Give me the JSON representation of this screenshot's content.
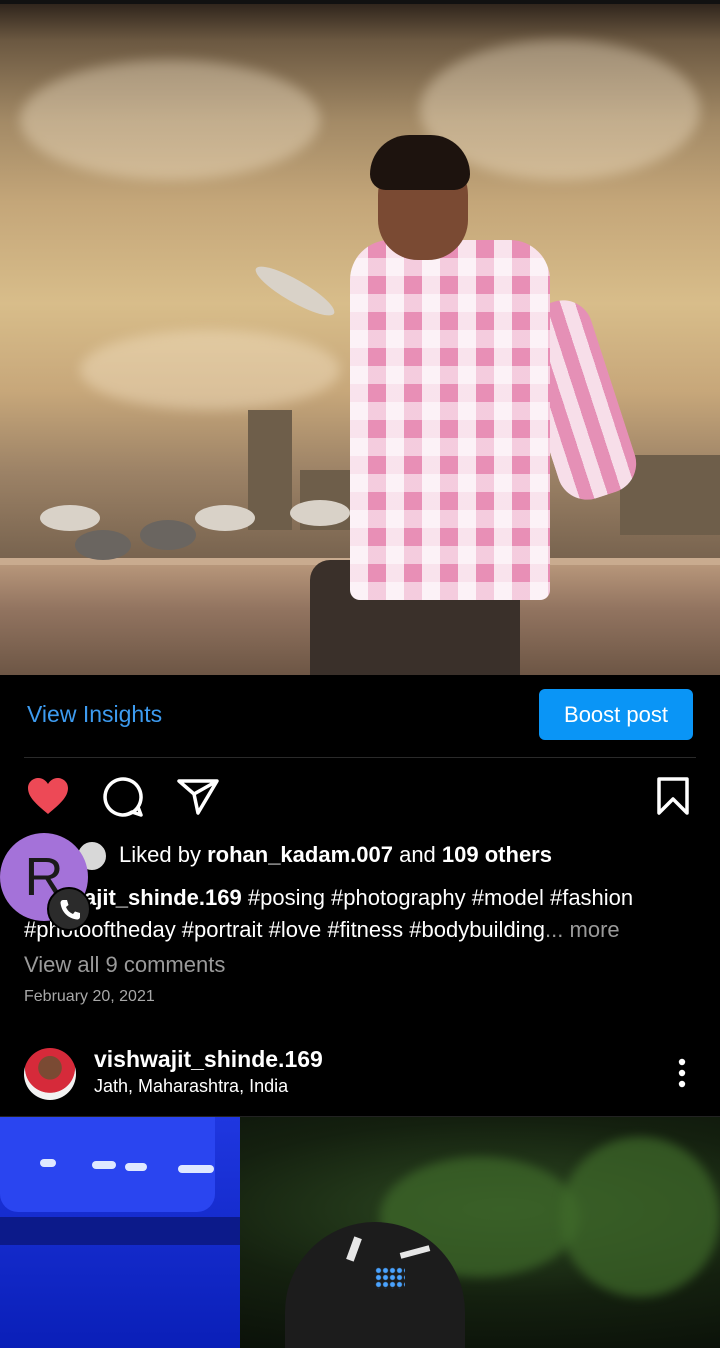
{
  "insights": {
    "view_label": "View Insights",
    "boost_label": "Boost post"
  },
  "actions": {
    "like": "heart-icon",
    "comment": "comment-icon",
    "share": "share-icon",
    "save": "bookmark-icon"
  },
  "likes": {
    "prefix": "Liked by",
    "liker": "rohan_kadam.007",
    "joiner": "and",
    "others": "109 others"
  },
  "caption": {
    "user": "ajit_shinde.169",
    "text": " #posing #photography #model #fashion #photooftheday #portrait #love #fitness #bodybuilding",
    "more_prefix": "...",
    "more": "more"
  },
  "comments_link": "View all 9 comments",
  "date": "February 20, 2021",
  "bubble": {
    "letter": "R"
  },
  "next_post": {
    "username": "vishwajit_shinde.169",
    "location": "Jath, Maharashtra, India"
  },
  "colors": {
    "accent": "#0a95f6",
    "link": "#3d9bf0",
    "like": "#ed4956",
    "bubble": "#a472d9"
  }
}
